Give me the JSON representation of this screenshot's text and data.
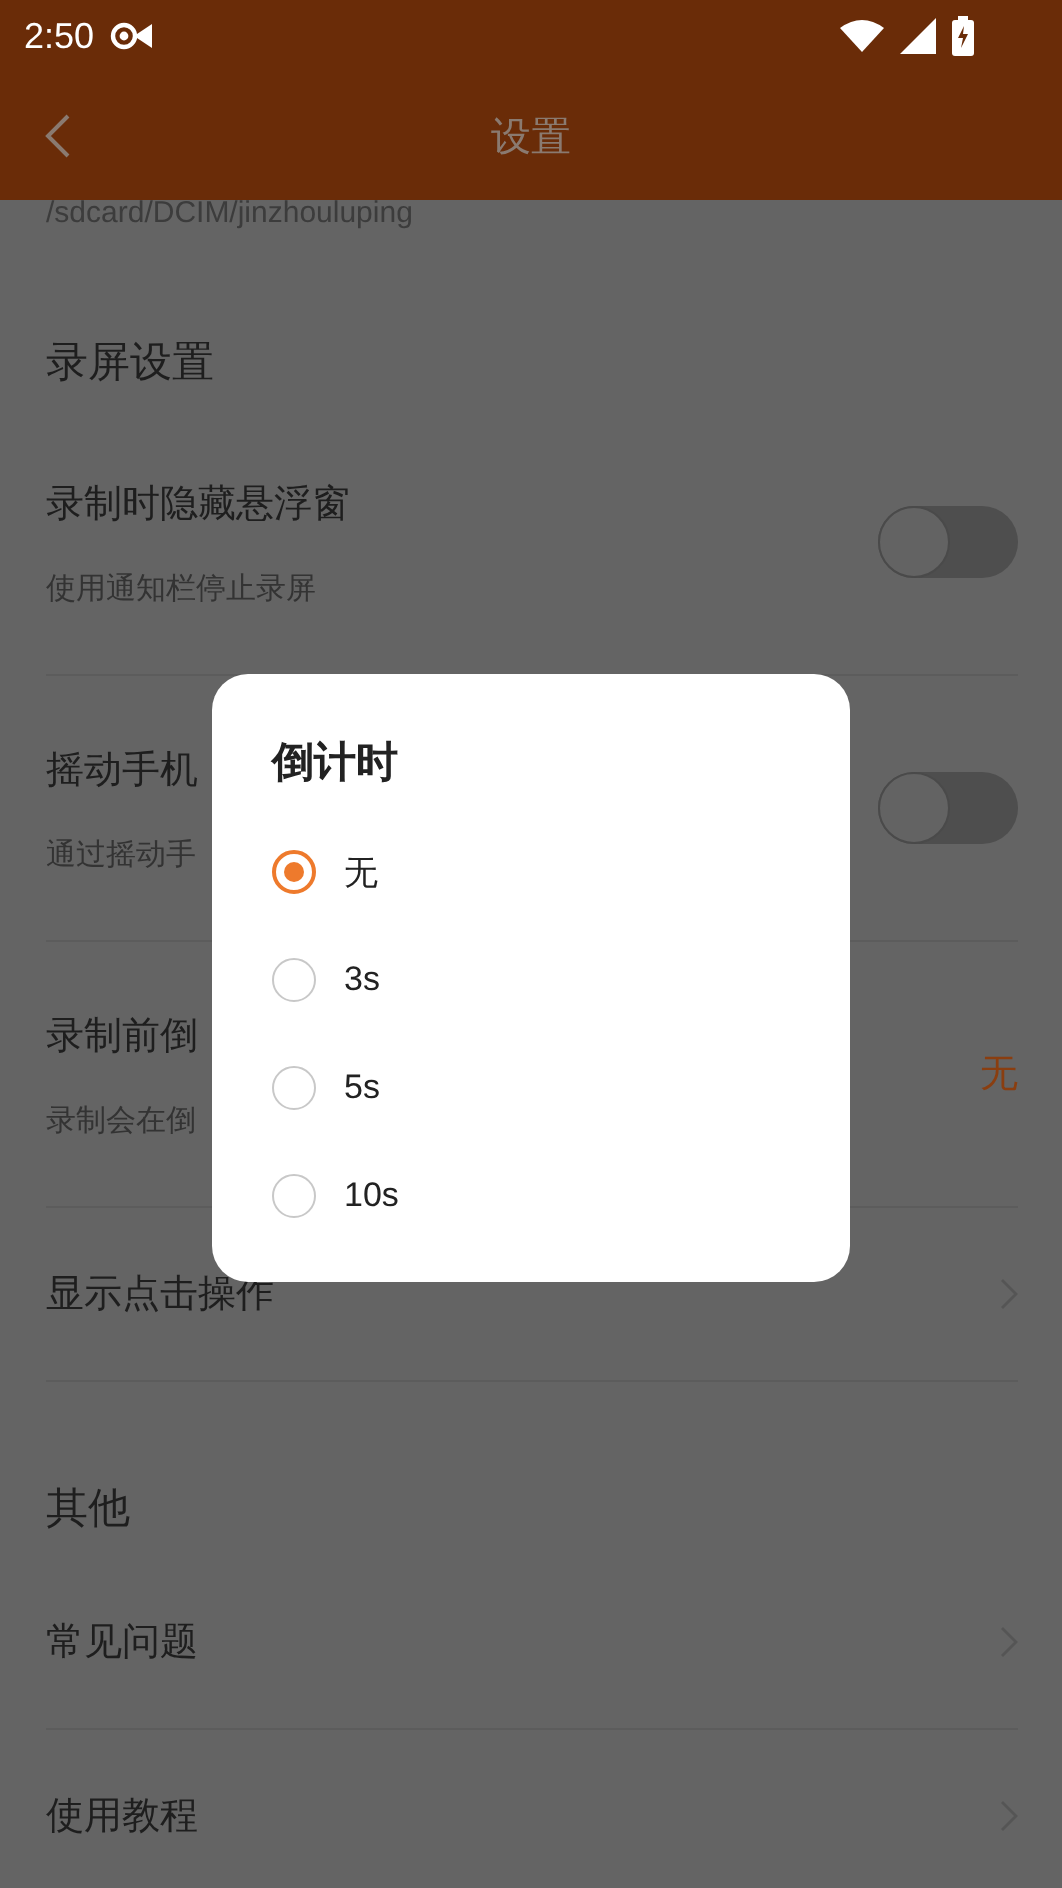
{
  "status_bar": {
    "time": "2:50"
  },
  "header": {
    "title": "设置"
  },
  "path_text": "/sdcard/DCIM/jinzhouluping",
  "sections": [
    {
      "title": "录屏设置",
      "rows": [
        {
          "kind": "toggle",
          "title": "录制时隐藏悬浮窗",
          "subtitle": "使用通知栏停止录屏",
          "on": false
        },
        {
          "kind": "toggle",
          "title": "摇动手机",
          "subtitle": "通过摇动手",
          "on": false
        },
        {
          "kind": "value",
          "title": "录制前倒",
          "subtitle": "录制会在倒",
          "value": "无"
        },
        {
          "kind": "link",
          "title": "显示点击操作"
        }
      ]
    },
    {
      "title": "其他",
      "rows": [
        {
          "kind": "link",
          "title": "常见问题"
        },
        {
          "kind": "link",
          "title": "使用教程"
        }
      ]
    }
  ],
  "dialog": {
    "title": "倒计时",
    "options": [
      {
        "label": "无",
        "selected": true
      },
      {
        "label": "3s",
        "selected": false
      },
      {
        "label": "5s",
        "selected": false
      },
      {
        "label": "10s",
        "selected": false
      }
    ]
  }
}
